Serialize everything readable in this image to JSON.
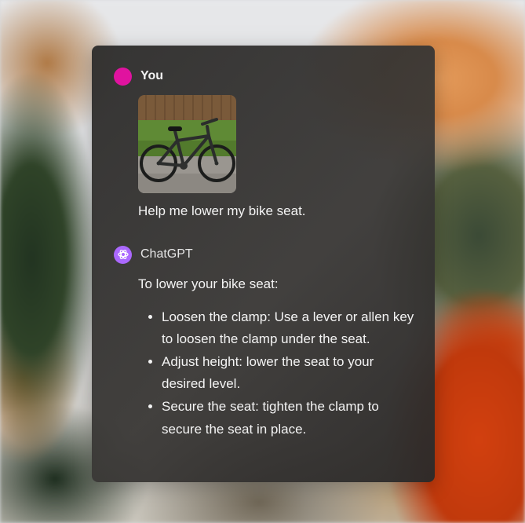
{
  "colors": {
    "user_avatar": "#e0139f",
    "assistant_avatar": "#ab68ff",
    "panel_bg": "#2e2d2c"
  },
  "conversation": {
    "user": {
      "name": "You",
      "attachment_icon": "bicycle-photo",
      "message": "Help me lower my bike seat."
    },
    "assistant": {
      "name": "ChatGPT",
      "avatar_icon": "openai-logo-icon",
      "intro": "To lower your bike seat:",
      "steps": [
        "Loosen the clamp: Use a lever or allen key to loosen the clamp under the seat.",
        "Adjust height: lower the seat to your desired level.",
        "Secure the seat: tighten the clamp to secure the seat in place."
      ]
    }
  }
}
